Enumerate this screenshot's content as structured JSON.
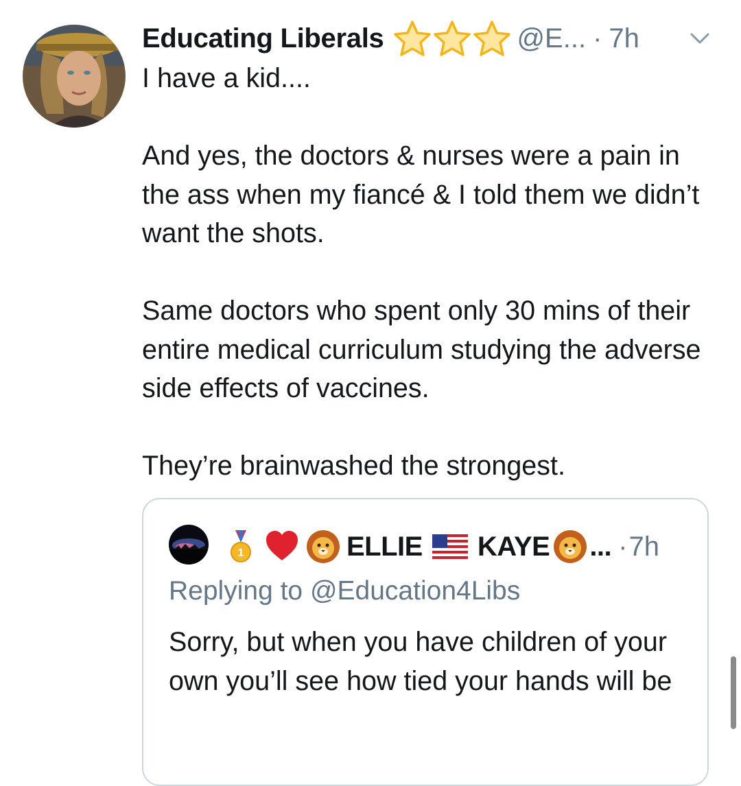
{
  "tweet": {
    "author_name": "Educating Liberals",
    "name_icons": [
      "star-emoji",
      "star-emoji",
      "star-emoji"
    ],
    "handle": "@E...",
    "separator": "·",
    "time": "7h",
    "paragraphs": [
      "I have a kid....",
      "And yes, the doctors & nurses were a pain in the ass when my fiancé & I told them we didn’t want the shots.",
      "Same doctors who spent only 30 mins of their entire medical curriculum studying the adverse side effects of vaccines.",
      "They’re brainwashed the strongest."
    ]
  },
  "quoted": {
    "name_part1": "ELLIE",
    "name_part2": "KAYE",
    "name_icons": [
      "medal-emoji",
      "red-heart-emoji",
      "lion-emoji",
      "us-flag-emoji",
      "lion-emoji"
    ],
    "ellipsis": "...",
    "separator": "·",
    "time": "7h",
    "replying_to": "Replying to @Education4Libs",
    "text": "Sorry, but when you have children of your own you’ll see how tied your hands will be"
  },
  "colors": {
    "text": "#14171a",
    "secondary": "#657786",
    "border": "#ccd6dd"
  }
}
